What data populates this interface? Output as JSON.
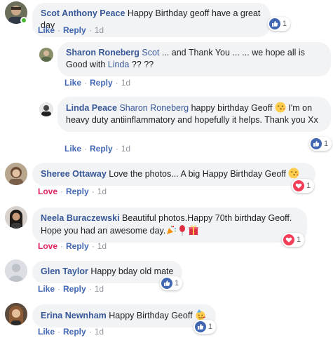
{
  "colors": {
    "link": "#385898",
    "action": "#4267b2",
    "love": "#e0245e",
    "meta": "#90949c",
    "bubble": "#f2f3f5",
    "online": "#42b72a"
  },
  "actions": {
    "like": "Like",
    "reply": "Reply",
    "love": "Love",
    "dot": "·"
  },
  "comments": [
    {
      "author": "Scot Anthony Peace",
      "text": "Happy Birthday geoff have a great day",
      "action": "Like",
      "time": "1d",
      "reaction": {
        "type": "like-icon",
        "count": "1"
      },
      "online": true,
      "replies": [
        {
          "author": "Sharon Roneberg",
          "mention1": "Scot",
          "text1": "... and Thank You ... ... we hope all is Good with",
          "mention2": "Linda",
          "text2": "?? ??",
          "action": "Like",
          "time": "1d"
        },
        {
          "author": "Linda Peace",
          "mention1": "Sharon Roneberg",
          "text1": "happy birthday Geoff",
          "emoji": "kissing-face-icon",
          "text2": "I'm on heavy duty antiinflammatory and hopefully it helps. Thank you Xx",
          "action": "Like",
          "time": "1d",
          "reaction": {
            "type": "like-icon",
            "count": "1"
          }
        }
      ]
    },
    {
      "author": "Sheree Ottaway",
      "text": "Love the photos... A big Happy Birthday Geoff",
      "emoji": "kissing-face-icon",
      "action": "Love",
      "time": "1d",
      "reaction": {
        "type": "heart-icon",
        "count": "1"
      }
    },
    {
      "author": "Neela Buraczewski",
      "text": "Beautiful photos.Happy 70th birthday Geoff. Hope you had an awesome day.",
      "emojis": [
        "party-popper-icon",
        "balloon-icon",
        "gift-icon"
      ],
      "action": "Love",
      "time": "1d",
      "reaction": {
        "type": "heart-icon",
        "count": "1"
      }
    },
    {
      "author": "Glen Taylor",
      "text": "Happy bday old mate",
      "action": "Like",
      "time": "1d",
      "reaction": {
        "type": "like-icon",
        "count": "1"
      }
    },
    {
      "author": "Erina Newnham",
      "text": "Happy Birthday Geoff",
      "emoji": "partying-face-icon",
      "action": "Like",
      "time": "1d",
      "reaction": {
        "type": "like-icon",
        "count": "1"
      }
    }
  ]
}
